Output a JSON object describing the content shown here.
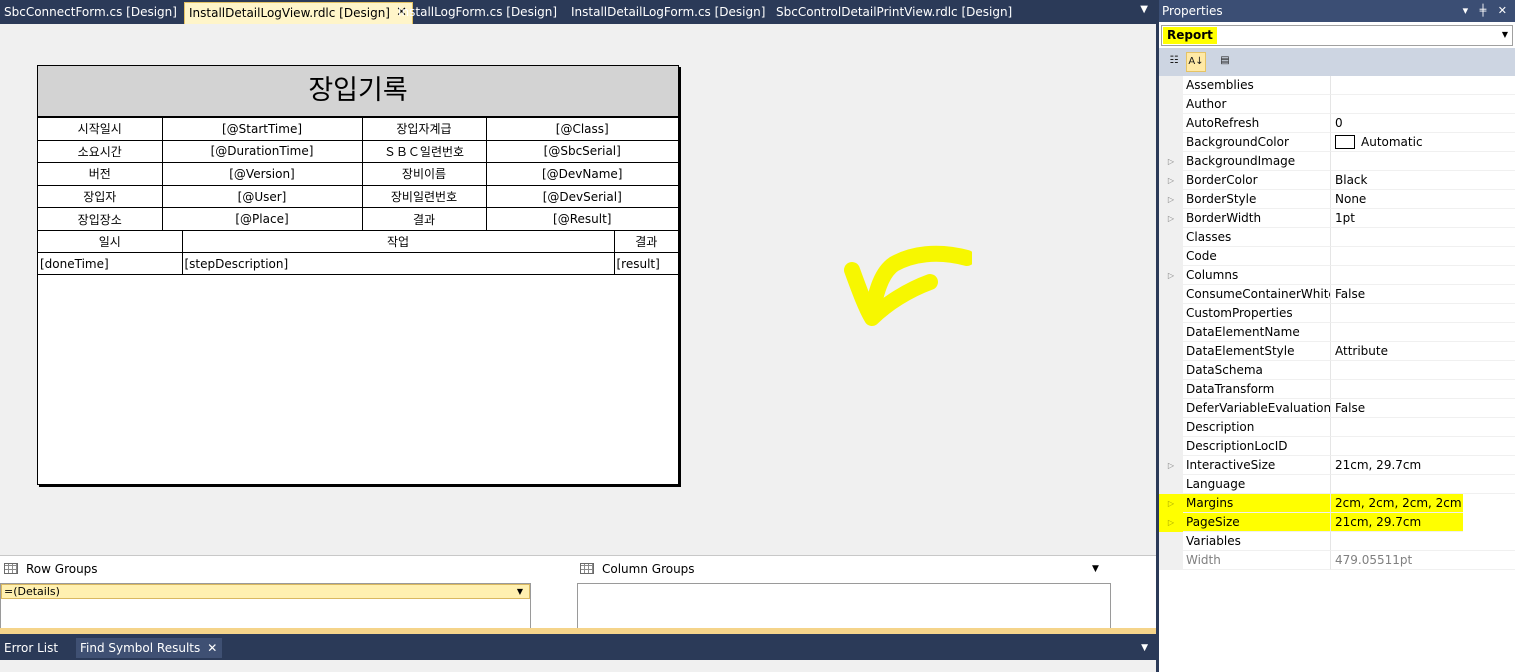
{
  "tabs": [
    {
      "label": "SbcConnectForm.cs [Design]",
      "active": false
    },
    {
      "label": "InstallDetailLogView.rdlc [Design]",
      "active": true
    },
    {
      "label": "InstallLogForm.cs [Design]",
      "active": false
    },
    {
      "label": "InstallDetailLogForm.cs [Design]",
      "active": false
    },
    {
      "label": "SbcControlDetailPrintView.rdlc [Design]",
      "active": false
    }
  ],
  "report": {
    "title": "장입기록",
    "header_rows": [
      [
        "시작일시",
        "[@StartTime]",
        "장입자계급",
        "[@Class]"
      ],
      [
        "소요시간",
        "[@DurationTime]",
        "ＳＢＣ일련번호",
        "[@SbcSerial]"
      ],
      [
        "버전",
        "[@Version]",
        "장비이름",
        "[@DevName]"
      ],
      [
        "장입자",
        "[@User]",
        "장비일련번호",
        "[@DevSerial]"
      ],
      [
        "장입장소",
        "[@Place]",
        "결과",
        "[@Result]"
      ]
    ],
    "detail_headers": [
      "일시",
      "작업",
      "결과"
    ],
    "detail_row": [
      "[doneTime]",
      "[stepDescription]",
      "[result]"
    ]
  },
  "groups": {
    "row_groups_label": "Row Groups",
    "column_groups_label": "Column Groups",
    "details_label": "=(Details)"
  },
  "bottom_tabs": [
    {
      "label": "Error List",
      "active": false
    },
    {
      "label": "Find Symbol Results",
      "active": true
    }
  ],
  "properties": {
    "title": "Properties",
    "title_icons": "▾ ╪ ✕",
    "object": "Report",
    "rows": [
      {
        "name": "Assemblies",
        "value": "",
        "expandable": false
      },
      {
        "name": "Author",
        "value": "",
        "expandable": false
      },
      {
        "name": "AutoRefresh",
        "value": "0",
        "expandable": false
      },
      {
        "name": "BackgroundColor",
        "value": "Automatic",
        "expandable": false,
        "swatch": true
      },
      {
        "name": "BackgroundImage",
        "value": "",
        "expandable": true
      },
      {
        "name": "BorderColor",
        "value": "Black",
        "expandable": true
      },
      {
        "name": "BorderStyle",
        "value": "None",
        "expandable": true
      },
      {
        "name": "BorderWidth",
        "value": "1pt",
        "expandable": true
      },
      {
        "name": "Classes",
        "value": "",
        "expandable": false
      },
      {
        "name": "Code",
        "value": "",
        "expandable": false
      },
      {
        "name": "Columns",
        "value": "",
        "expandable": true
      },
      {
        "name": "ConsumeContainerWhitespace",
        "value": "False",
        "expandable": false
      },
      {
        "name": "CustomProperties",
        "value": "",
        "expandable": false
      },
      {
        "name": "DataElementName",
        "value": "",
        "expandable": false
      },
      {
        "name": "DataElementStyle",
        "value": "Attribute",
        "expandable": false
      },
      {
        "name": "DataSchema",
        "value": "",
        "expandable": false
      },
      {
        "name": "DataTransform",
        "value": "",
        "expandable": false
      },
      {
        "name": "DeferVariableEvaluation",
        "value": "False",
        "expandable": false
      },
      {
        "name": "Description",
        "value": "",
        "expandable": false
      },
      {
        "name": "DescriptionLocID",
        "value": "",
        "expandable": false
      },
      {
        "name": "InteractiveSize",
        "value": "21cm, 29.7cm",
        "expandable": true
      },
      {
        "name": "Language",
        "value": "",
        "expandable": false
      },
      {
        "name": "Margins",
        "value": "2cm, 2cm, 2cm, 2cm",
        "expandable": true,
        "highlight": true
      },
      {
        "name": "PageSize",
        "value": "21cm, 29.7cm",
        "expandable": true,
        "highlight": true
      },
      {
        "name": "Variables",
        "value": "",
        "expandable": false
      },
      {
        "name": "Width",
        "value": "479.05511pt",
        "expandable": false,
        "readonly": true
      }
    ]
  },
  "colors": {
    "highlight": "#ffff00",
    "chrome": "#2b3a58",
    "active_tab": "#fff5c9"
  }
}
